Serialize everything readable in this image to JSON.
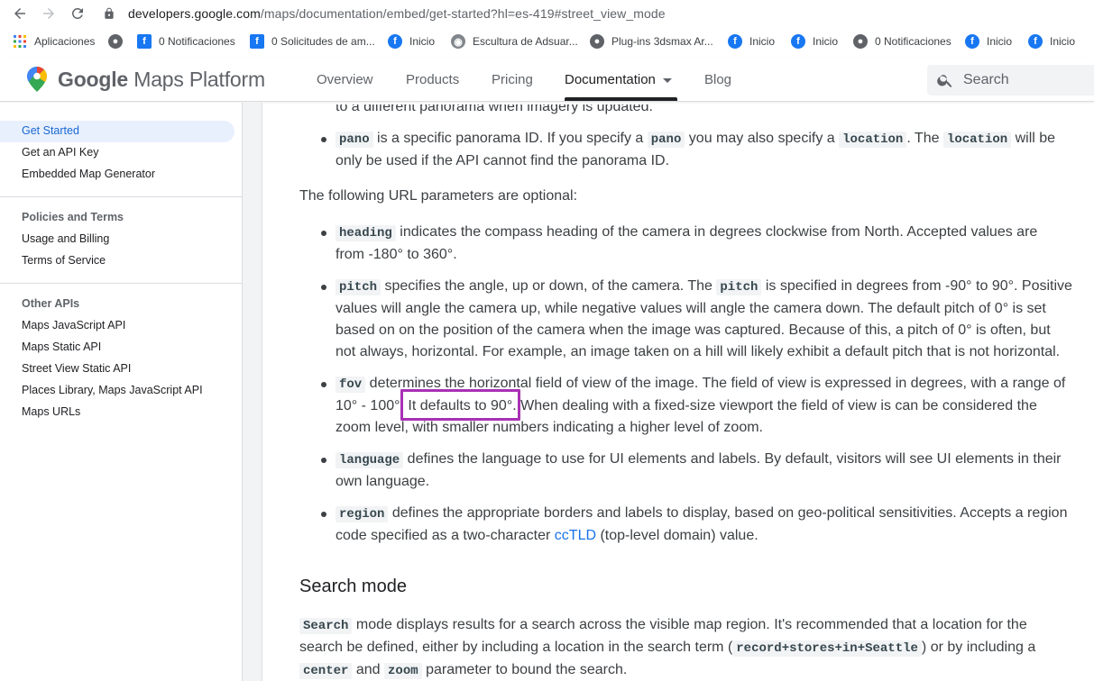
{
  "browser": {
    "url_host": "developers.google.com",
    "url_path": "/maps/documentation/embed/get-started?hl=es-419#street_view_mode",
    "bookmarks": [
      {
        "label": "Aplicaciones",
        "icon": "apps-grid-icon"
      },
      {
        "label": "",
        "icon": "globe-icon"
      },
      {
        "label": "0 Notificaciones",
        "icon": "facebook-icon"
      },
      {
        "label": "0 Solicitudes de am...",
        "icon": "facebook-icon"
      },
      {
        "label": "Inicio",
        "icon": "facebook-icon"
      },
      {
        "label": "Escultura de Adsuar...",
        "icon": "sculpture-icon"
      },
      {
        "label": "Plug-ins 3dsmax Ar...",
        "icon": "globe-icon"
      },
      {
        "label": "Inicio",
        "icon": "facebook-icon"
      },
      {
        "label": "Inicio",
        "icon": "facebook-icon"
      },
      {
        "label": "0 Notificaciones",
        "icon": "globe-icon"
      },
      {
        "label": "Inicio",
        "icon": "facebook-icon"
      },
      {
        "label": "Inicio",
        "icon": "facebook-icon"
      }
    ]
  },
  "header": {
    "logo_google": "Google",
    "logo_product": "Maps Platform",
    "nav": [
      "Overview",
      "Products",
      "Pricing",
      "Documentation",
      "Blog"
    ],
    "active_nav": "Documentation",
    "search_placeholder": "Search"
  },
  "sidebar": {
    "group1": [
      "Get Started",
      "Get an API Key",
      "Embedded Map Generator"
    ],
    "active": "Get Started",
    "group2_title": "Policies and Terms",
    "group2": [
      "Usage and Billing",
      "Terms of Service"
    ],
    "group3_title": "Other APIs",
    "group3": [
      "Maps JavaScript API",
      "Maps Static API",
      "Street View Static API",
      "Places Library, Maps JavaScript API",
      "Maps URLs"
    ]
  },
  "content": {
    "cut_line": "to a different panorama when imagery is updated.",
    "pano": {
      "code1": "pano",
      "t1": " is a specific panorama ID. If you specify a ",
      "code2": "pano",
      "t2": " you may also specify a ",
      "code3": "location",
      "t3": ". The ",
      "code4": "location",
      "t4": " will be",
      "line2": "only be used if the API cannot find the panorama ID."
    },
    "optional_intro": "The following URL parameters are optional:",
    "heading": {
      "code": "heading",
      "t1": " indicates the compass heading of the camera in degrees clockwise from North. Accepted values are",
      "line2": "from -180° to 360°."
    },
    "pitch": {
      "code1": "pitch",
      "t1": " specifies the angle, up or down, of the camera. The ",
      "code2": "pitch",
      "t2": " is specified in degrees from -90° to 90°. Positive",
      "line2": "values will angle the camera up, while negative values will angle the camera down. The default pitch of 0° is set",
      "line3": "based on on the position of the camera when the image was captured. Because of this, a pitch of 0° is often, but",
      "line4": "not always, horizontal. For example, an image taken on a hill will likely exhibit a default pitch that is not horizontal."
    },
    "fov": {
      "code": "fov",
      "t1": " determines the horizontal field of view of the image. The field of view is expressed in degrees, with a range of",
      "line2a": "10° - 100°. ",
      "line2b": "It defaults to 90°.",
      "line2c": " When dealing with a fixed-size viewport the field of view is can be considered the",
      "line3": "zoom level, with smaller numbers indicating a higher level of zoom."
    },
    "language": {
      "code": "language",
      "t1": " defines the language to use for UI elements and labels. By default, visitors will see UI elements in their",
      "line2": "own language."
    },
    "region": {
      "code": "region",
      "t1": " defines the appropriate borders and labels to display, based on geo-political sensitivities. Accepts a region",
      "line2a": "code specified as a two-character ",
      "link": "ccTLD",
      "line2b": " (top-level domain) value."
    },
    "search_mode_title": "Search mode",
    "search": {
      "code1": "Search",
      "t1": " mode displays results for a search across the visible map region. It's recommended that a location for the",
      "line2a": "search be defined, either by including a location in the search term (",
      "code2": "record+stores+in+Seattle",
      "line2b": ") or by including a",
      "code3": "center",
      "t3": " and ",
      "code4": "zoom",
      "t4": " parameter to bound the search."
    }
  },
  "colors": {
    "highlight_box": "#a831b4",
    "link": "#1a73e8",
    "active_sidebar": "#1967d2"
  }
}
